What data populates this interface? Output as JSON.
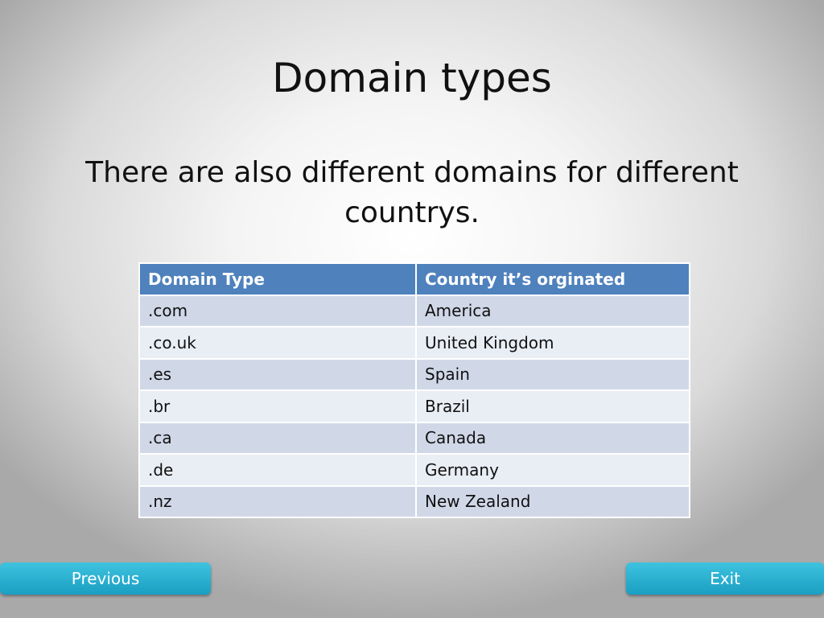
{
  "slide": {
    "title": "Domain types",
    "subtitle": "There are also different domains for different countrys."
  },
  "table": {
    "headers": [
      "Domain Type",
      "Country it’s orginated"
    ],
    "rows": [
      [
        ".com",
        "America"
      ],
      [
        ".co.uk",
        "United Kingdom"
      ],
      [
        ".es",
        "Spain"
      ],
      [
        ".br",
        "Brazil"
      ],
      [
        ".ca",
        "Canada"
      ],
      [
        ".de",
        "Germany"
      ],
      [
        ".nz",
        "New Zealand"
      ]
    ]
  },
  "nav": {
    "previous_label": "Previous",
    "exit_label": "Exit"
  },
  "colors": {
    "header_bg": "#4f81bd",
    "row_band_dark": "#d0d8e8",
    "row_band_light": "#e9edf4",
    "button_bg": "#2bb3d6"
  }
}
